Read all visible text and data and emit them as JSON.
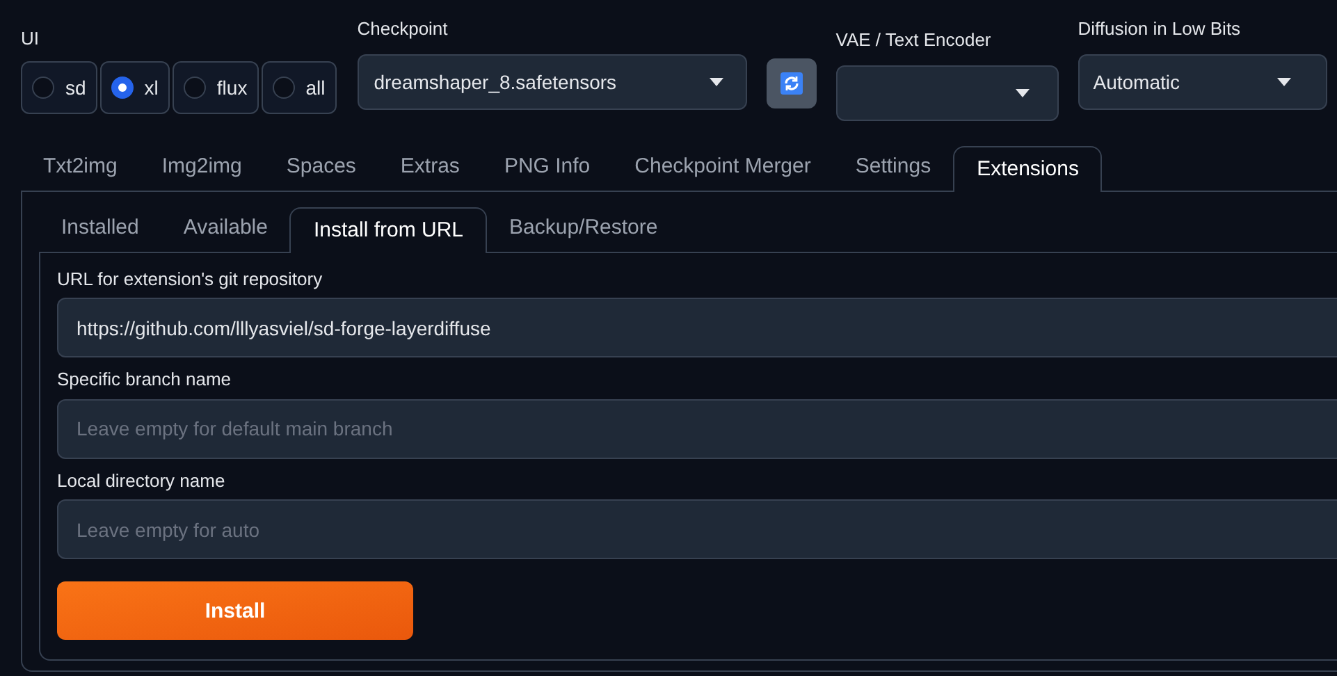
{
  "ui": {
    "label": "UI",
    "options": [
      {
        "label": "sd",
        "selected": false
      },
      {
        "label": "xl",
        "selected": true
      },
      {
        "label": "flux",
        "selected": false
      },
      {
        "label": "all",
        "selected": false
      }
    ]
  },
  "checkpoint": {
    "label": "Checkpoint",
    "value": "dreamshaper_8.safetensors"
  },
  "vae": {
    "label": "VAE / Text Encoder"
  },
  "diffusion": {
    "label": "Diffusion in Low Bits",
    "value": "Automatic"
  },
  "tabs": [
    {
      "label": "Txt2img",
      "selected": false
    },
    {
      "label": "Img2img",
      "selected": false
    },
    {
      "label": "Spaces",
      "selected": false
    },
    {
      "label": "Extras",
      "selected": false
    },
    {
      "label": "PNG Info",
      "selected": false
    },
    {
      "label": "Checkpoint Merger",
      "selected": false
    },
    {
      "label": "Settings",
      "selected": false
    },
    {
      "label": "Extensions",
      "selected": true
    }
  ],
  "subtabs": [
    {
      "label": "Installed",
      "selected": false
    },
    {
      "label": "Available",
      "selected": false
    },
    {
      "label": "Install from URL",
      "selected": true
    },
    {
      "label": "Backup/Restore",
      "selected": false
    }
  ],
  "fields": [
    {
      "label": "URL for extension's git repository",
      "value": "https://github.com/lllyasviel/sd-forge-layerdiffuse"
    },
    {
      "label": "Specific branch name",
      "placeholder": "Leave empty for default main branch"
    },
    {
      "label": "Local directory name",
      "placeholder": "Leave empty for auto"
    }
  ],
  "install_button": "Install"
}
